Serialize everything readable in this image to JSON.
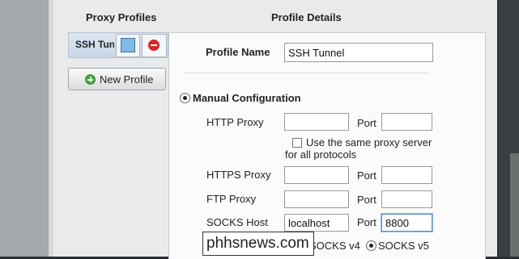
{
  "left_pane": {
    "header": "Proxy Profiles",
    "profiles": [
      {
        "name": "SSH Tunnel",
        "color": "#7fbbe8"
      }
    ],
    "new_profile_label": "New Profile"
  },
  "details": {
    "header": "Profile Details",
    "profile_name_label": "Profile Name",
    "profile_name_value": "SSH Tunnel",
    "manual_config_label": "Manual Configuration",
    "http_proxy_label": "HTTP Proxy",
    "http_host": "",
    "http_port": "",
    "port_label": "Port",
    "same_proxy_label_line1": "Use the same proxy server",
    "same_proxy_label_line2": "for all protocols",
    "same_proxy_checked": false,
    "https_proxy_label": "HTTPS Proxy",
    "https_host": "",
    "https_port": "",
    "ftp_proxy_label": "FTP Proxy",
    "ftp_host": "",
    "ftp_port": "",
    "socks_host_label": "SOCKS Host",
    "socks_host": "localhost",
    "socks_port": "8800",
    "socks_v4_label": "SOCKS v4",
    "socks_v5_label": "SOCKS v5",
    "socks_version_selected": "SOCKS v5"
  },
  "watermark": "phhsnews.com"
}
